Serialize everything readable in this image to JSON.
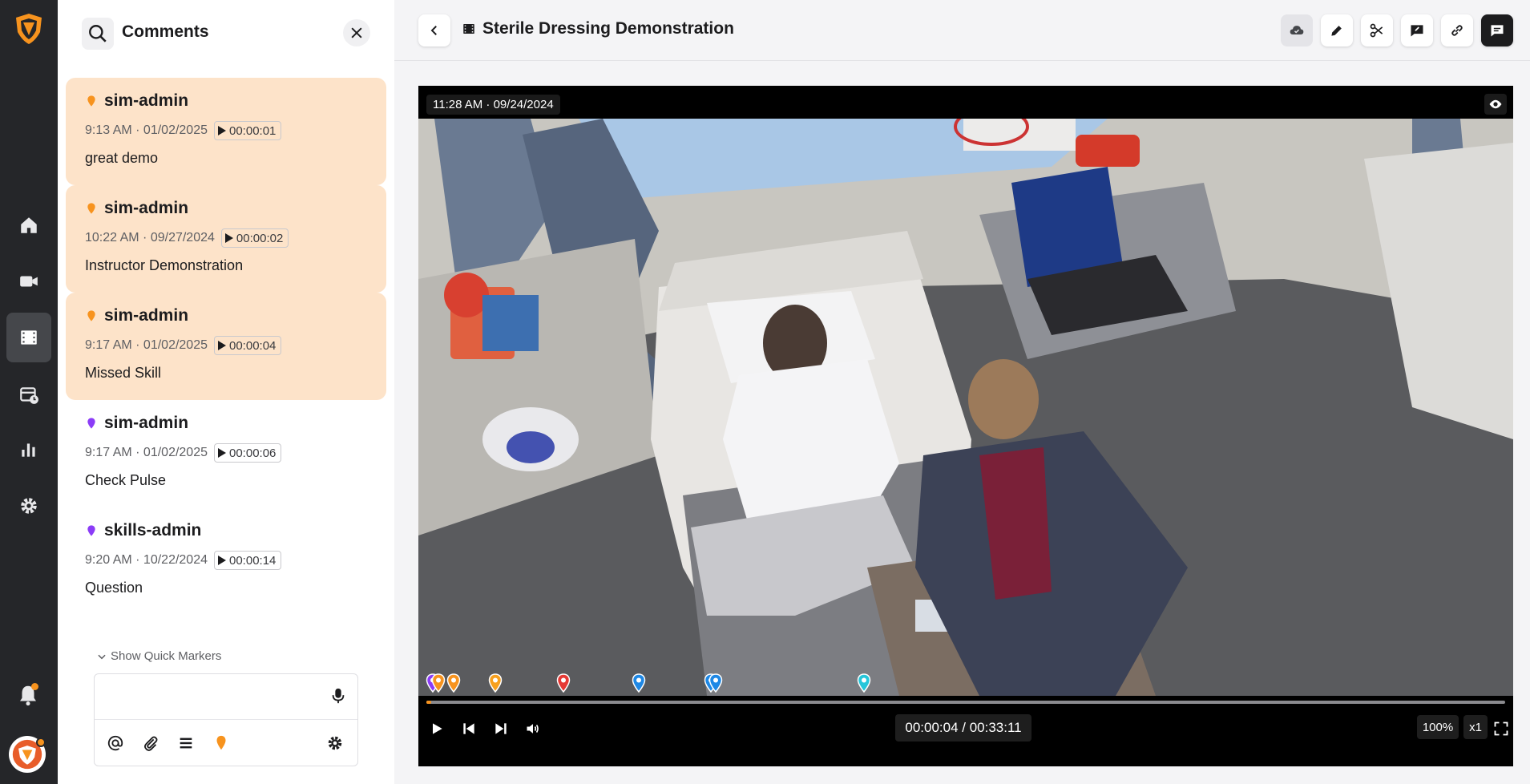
{
  "brand": {
    "accent": "#f7931e",
    "highlight_bg": "#fde3c9",
    "rail_bg": "#252629"
  },
  "rail": {
    "items": [
      {
        "icon": "home-icon"
      },
      {
        "icon": "camera-icon"
      },
      {
        "icon": "recordings-icon",
        "active": true
      },
      {
        "icon": "schedule-icon"
      },
      {
        "icon": "analytics-icon"
      },
      {
        "icon": "gear-icon"
      }
    ]
  },
  "comments_panel": {
    "title": "Comments",
    "items": [
      {
        "user": "sim-admin",
        "date": "9:13 AM · 01/02/2025",
        "timestamp": "00:00:01",
        "text": "great demo",
        "marker_color": "#f7931e",
        "highlighted": true
      },
      {
        "user": "sim-admin",
        "date": "10:22 AM · 09/27/2024",
        "timestamp": "00:00:02",
        "text": "Instructor Demonstration",
        "marker_color": "#f7931e",
        "highlighted": true
      },
      {
        "user": "sim-admin",
        "date": "9:17 AM · 01/02/2025",
        "timestamp": "00:00:04",
        "text": "Missed Skill",
        "marker_color": "#f7931e",
        "highlighted": true
      },
      {
        "user": "sim-admin",
        "date": "9:17 AM · 01/02/2025",
        "timestamp": "00:00:06",
        "text": "Check Pulse",
        "marker_color": "#8b3cf7",
        "highlighted": false
      },
      {
        "user": "skills-admin",
        "date": "9:20 AM · 10/22/2024",
        "timestamp": "00:00:14",
        "text": "Question",
        "marker_color": "#8b3cf7",
        "highlighted": false
      }
    ],
    "quick_markers_label": "Show Quick Markers",
    "input_placeholder": ""
  },
  "header": {
    "title": "Sterile Dressing Demonstration"
  },
  "video": {
    "recorded_at": "11:28 AM · 09/24/2024",
    "current_time": "00:00:04 / 00:33:11",
    "progress": 0.002,
    "zoom": "100%",
    "speed": "x1",
    "markers": [
      {
        "pos": 0.006,
        "color": "#8b3cf7"
      },
      {
        "pos": 0.011,
        "color": "#f7931e"
      },
      {
        "pos": 0.025,
        "color": "#f7931e"
      },
      {
        "pos": 0.064,
        "color": "#f7a01e"
      },
      {
        "pos": 0.127,
        "color": "#e53935"
      },
      {
        "pos": 0.197,
        "color": "#1e88e5"
      },
      {
        "pos": 0.264,
        "color": "#1e88e5"
      },
      {
        "pos": 0.268,
        "color": "#1e88e5"
      },
      {
        "pos": 0.406,
        "color": "#26c6da"
      }
    ]
  }
}
